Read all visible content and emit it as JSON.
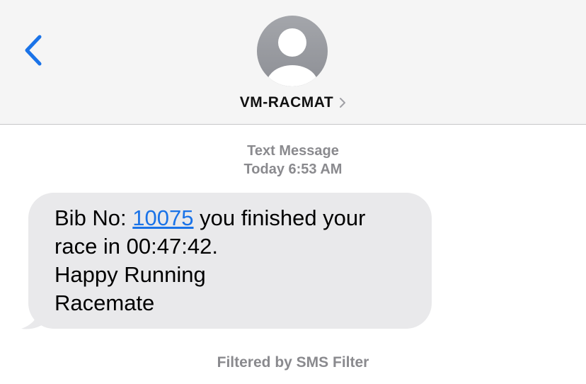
{
  "header": {
    "back_icon": "chevron-left-icon",
    "avatar_icon": "person-silhouette-icon",
    "contact_name": "VM-RACMAT",
    "contact_chevron_icon": "chevron-right-icon"
  },
  "thread": {
    "message_type": "Text Message",
    "timestamp": "Today 6:53 AM"
  },
  "message": {
    "line1_prefix": "Bib No: ",
    "bib_link": "10075",
    "line1_suffix": " you finished your",
    "line2": "race in 00:47:42.",
    "line3": "Happy Running",
    "line4": "Racemate"
  },
  "footer": {
    "filter_note": "Filtered by SMS Filter"
  },
  "colors": {
    "accent": "#1a73e8",
    "bubble": "#e9e9eb",
    "header_bg": "#f5f5f5",
    "secondary_text": "#8a8a8e"
  }
}
